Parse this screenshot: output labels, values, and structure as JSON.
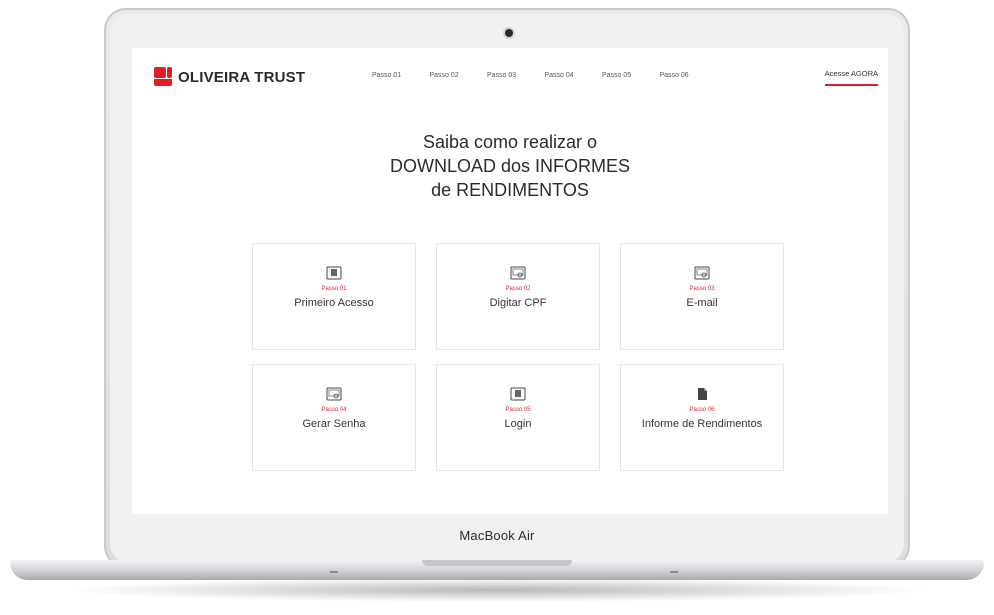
{
  "device": {
    "label": "MacBook Air"
  },
  "header": {
    "brand": "OLIVEIRA TRUST",
    "nav": [
      "Passo 01",
      "Passo 02",
      "Passo 03",
      "Passo 04",
      "Passo 05",
      "Passo 06"
    ],
    "access": "Acesse AGORA"
  },
  "hero": {
    "line1": "Saiba como realizar o",
    "line2": "DOWNLOAD dos INFORMES",
    "line3": "de RENDIMENTOS"
  },
  "steps": [
    {
      "step": "Passo 01",
      "label": "Primeiro Acesso",
      "icon": "monitor-icon"
    },
    {
      "step": "Passo 02",
      "label": "Digitar CPF",
      "icon": "screen-search-icon"
    },
    {
      "step": "Passo 03",
      "label": "E-mail",
      "icon": "screen-search-icon"
    },
    {
      "step": "Passo 04",
      "label": "Gerar Senha",
      "icon": "screen-search-icon"
    },
    {
      "step": "Passo 05",
      "label": "Login",
      "icon": "monitor-icon"
    },
    {
      "step": "Passo 06",
      "label": "Informe de Rendimentos",
      "icon": "document-icon"
    }
  ],
  "colors": {
    "accent": "#e21d28",
    "text": "#333333",
    "border": "#e6e6e6"
  }
}
